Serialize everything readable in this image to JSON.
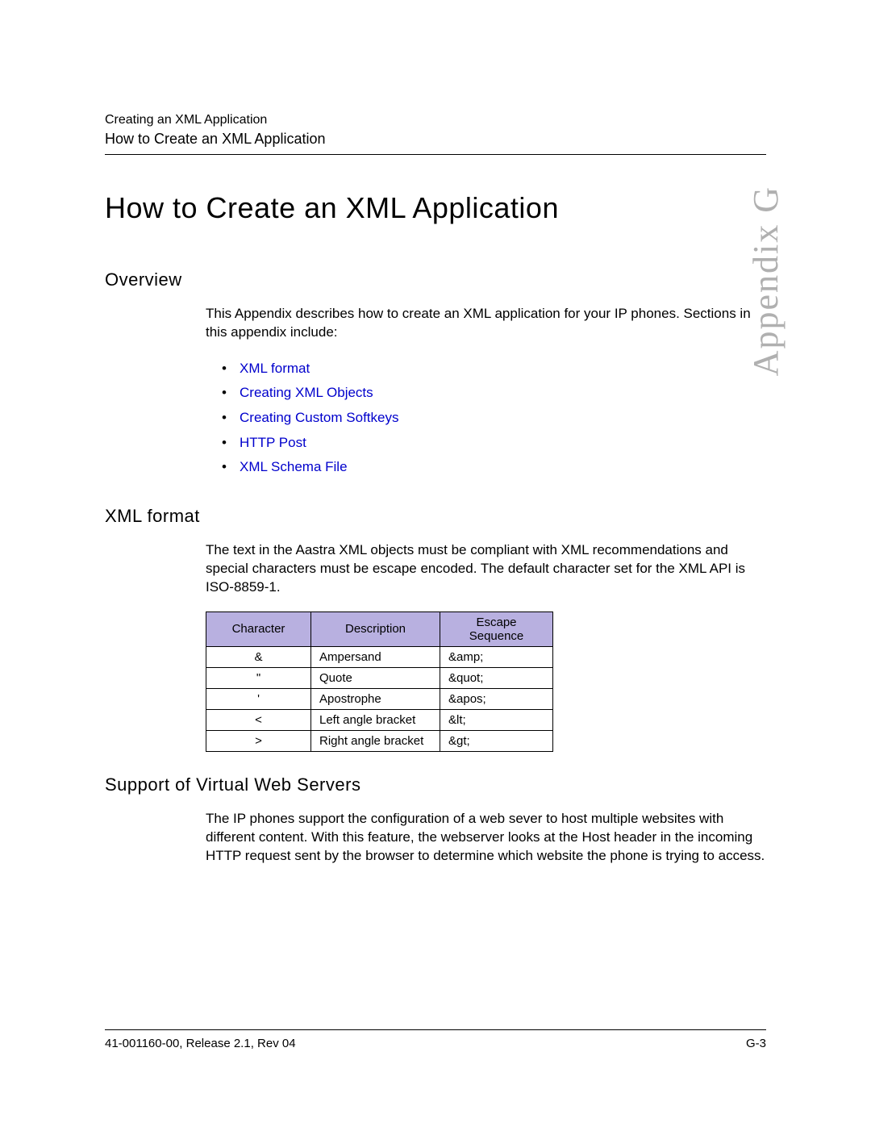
{
  "header": {
    "line1": "Creating an XML Application",
    "line2": "How to Create an XML Application"
  },
  "main_title": "How to Create an XML Application",
  "side_label": "Appendix G",
  "overview": {
    "title": "Overview",
    "text": "This Appendix describes how to create an XML application for your IP phones. Sections in this appendix include:",
    "links": [
      "XML format",
      "Creating XML Objects",
      "Creating Custom Softkeys",
      "HTTP Post",
      "XML Schema File"
    ]
  },
  "xml_format": {
    "title": "XML format",
    "text": "The text in the Aastra XML objects must be compliant with XML recommendations and special characters must be escape encoded. The default character set for the XML API is ISO-8859-1.",
    "table": {
      "headers": [
        "Character",
        "Description",
        "Escape Sequence"
      ],
      "rows": [
        {
          "char": "&",
          "desc": "Ampersand",
          "esc": "&amp;"
        },
        {
          "char": "\"",
          "desc": "Quote",
          "esc": "&quot;"
        },
        {
          "char": "'",
          "desc": "Apostrophe",
          "esc": "&apos;"
        },
        {
          "char": "<",
          "desc": "Left angle bracket",
          "esc": "&lt;"
        },
        {
          "char": ">",
          "desc": "Right angle bracket",
          "esc": "&gt;"
        }
      ]
    }
  },
  "virtual_web": {
    "title": "Support of Virtual Web Servers",
    "text": "The IP phones support the configuration of a web sever to host multiple websites with different content. With this feature, the webserver looks at the Host header in the incoming HTTP request sent by the browser to determine which website the phone is trying to access."
  },
  "footer": {
    "left": "41-001160-00, Release 2.1, Rev 04",
    "right": "G-3"
  }
}
